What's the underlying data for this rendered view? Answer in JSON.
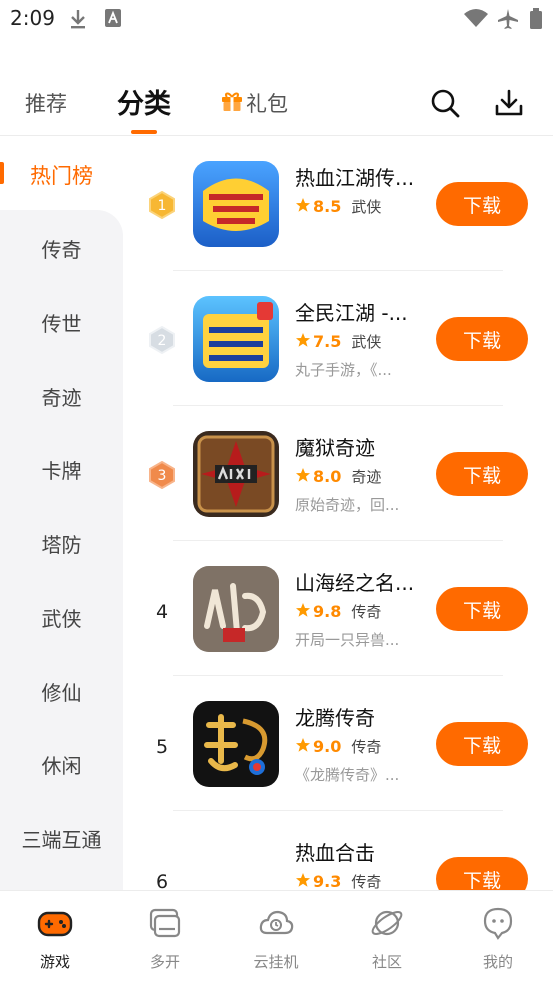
{
  "status_bar": {
    "time": "2:09"
  },
  "top_tabs": {
    "recommend": "推荐",
    "category": "分类",
    "gift": "礼包"
  },
  "sidebar": {
    "hot": "热门榜",
    "items": [
      "传奇",
      "传世",
      "奇迹",
      "卡牌",
      "塔防",
      "武侠",
      "修仙",
      "休闲",
      "三端互通"
    ]
  },
  "games": [
    {
      "rank": "1",
      "title": "热血江湖传...",
      "score": "8.5",
      "genre": "武侠",
      "desc": "",
      "download": "下载"
    },
    {
      "rank": "2",
      "title": "全民江湖 -...",
      "score": "7.5",
      "genre": "武侠",
      "desc": "丸子手游，《...",
      "download": "下载"
    },
    {
      "rank": "3",
      "title": "魔狱奇迹",
      "score": "8.0",
      "genre": "奇迹",
      "desc": "原始奇迹，回...",
      "download": "下载"
    },
    {
      "rank": "4",
      "title": "山海经之名...",
      "score": "9.8",
      "genre": "传奇",
      "desc": "开局一只异兽...",
      "download": "下载"
    },
    {
      "rank": "5",
      "title": "龙腾传奇",
      "score": "9.0",
      "genre": "传奇",
      "desc": "《龙腾传奇》...",
      "download": "下载"
    },
    {
      "rank": "6",
      "title": "热血合击",
      "score": "9.3",
      "genre": "传奇",
      "desc": "",
      "download": "下载"
    }
  ],
  "bottom_nav": {
    "items": [
      "游戏",
      "多开",
      "云挂机",
      "社区",
      "我的"
    ],
    "active_index": 0
  },
  "colors": {
    "accent": "#ff6a00",
    "star": "#ff9a00",
    "sidebar_bg": "#f4f4f6"
  },
  "icons": {
    "status": [
      "download-icon",
      "a-icon",
      "wifi-icon",
      "airplane-icon",
      "battery-icon"
    ],
    "header": [
      "search-icon",
      "download-icon"
    ],
    "nav": [
      "gamepad-icon",
      "multi-window-icon",
      "cloud-icon",
      "planet-icon",
      "chat-icon"
    ]
  }
}
